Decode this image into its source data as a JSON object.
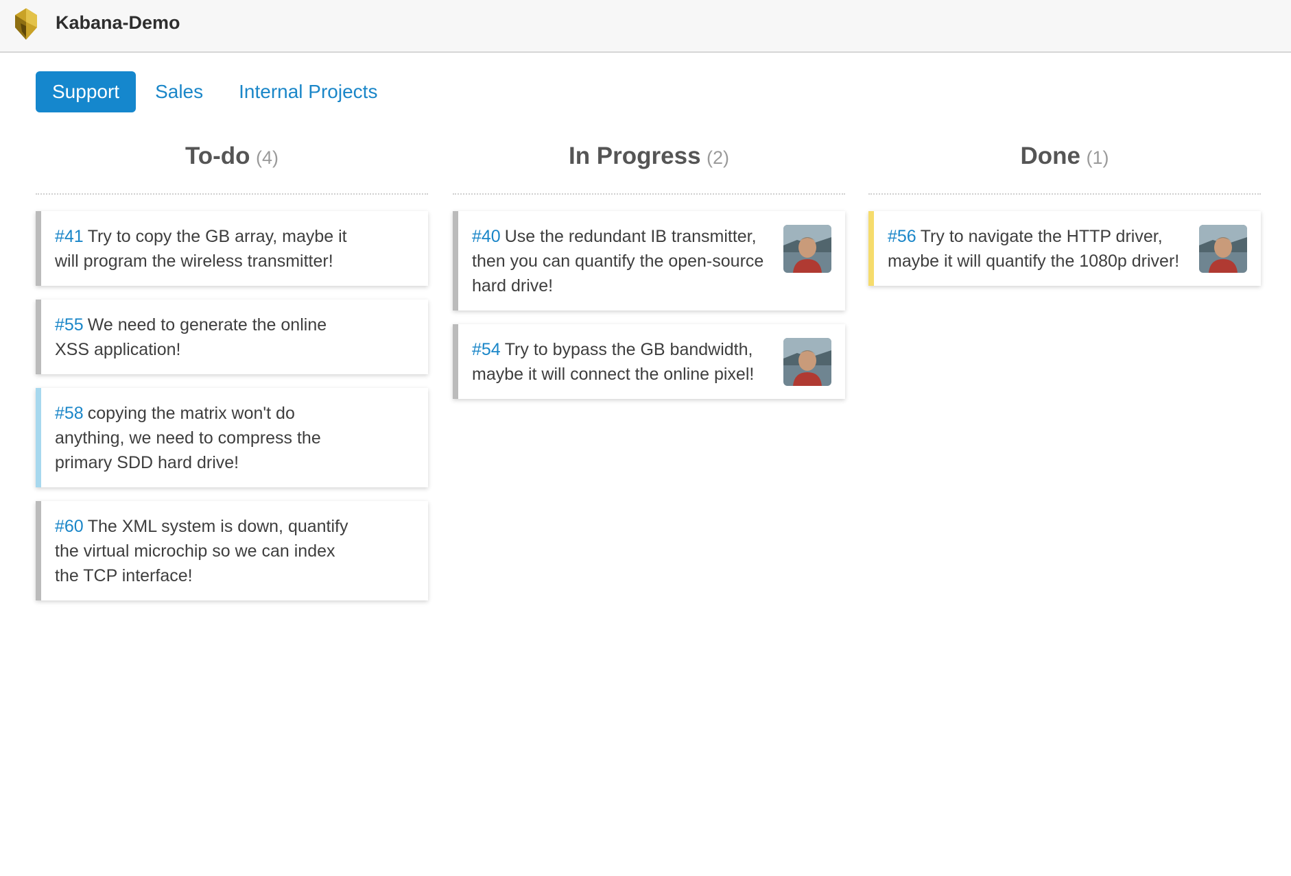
{
  "app": {
    "title": "Kabana-Demo",
    "logo_icon": "helmet-logo-icon"
  },
  "tabs": [
    {
      "label": "Support",
      "active": true
    },
    {
      "label": "Sales",
      "active": false
    },
    {
      "label": "Internal Projects",
      "active": false
    }
  ],
  "columns": [
    {
      "title": "To-do",
      "count": "(4)",
      "cards": [
        {
          "id": "#41",
          "text": "Try to copy the GB array, maybe it will program the wireless transmitter!",
          "color": "#bbbbbb",
          "avatar": false
        },
        {
          "id": "#55",
          "text": "We need to generate the online XSS application!",
          "color": "#bbbbbb",
          "avatar": false
        },
        {
          "id": "#58",
          "text": "copying the matrix won't do anything, we need to compress the primary SDD hard drive!",
          "color": "#a7d8ee",
          "avatar": false
        },
        {
          "id": "#60",
          "text": "The XML system is down, quantify the virtual microchip so we can index the TCP interface!",
          "color": "#bbbbbb",
          "avatar": false
        }
      ]
    },
    {
      "title": "In Progress",
      "count": "(2)",
      "cards": [
        {
          "id": "#40",
          "text": "Use the redundant IB transmitter, then you can quantify the open-source hard drive!",
          "color": "#bbbbbb",
          "avatar": true
        },
        {
          "id": "#54",
          "text": "Try to bypass the GB bandwidth, maybe it will connect the online pixel!",
          "color": "#bbbbbb",
          "avatar": true
        }
      ]
    },
    {
      "title": "Done",
      "count": "(1)",
      "cards": [
        {
          "id": "#56",
          "text": "Try to navigate the HTTP driver, maybe it will quantify the 1080p driver!",
          "color": "#f6dc6c",
          "avatar": true
        }
      ]
    }
  ]
}
